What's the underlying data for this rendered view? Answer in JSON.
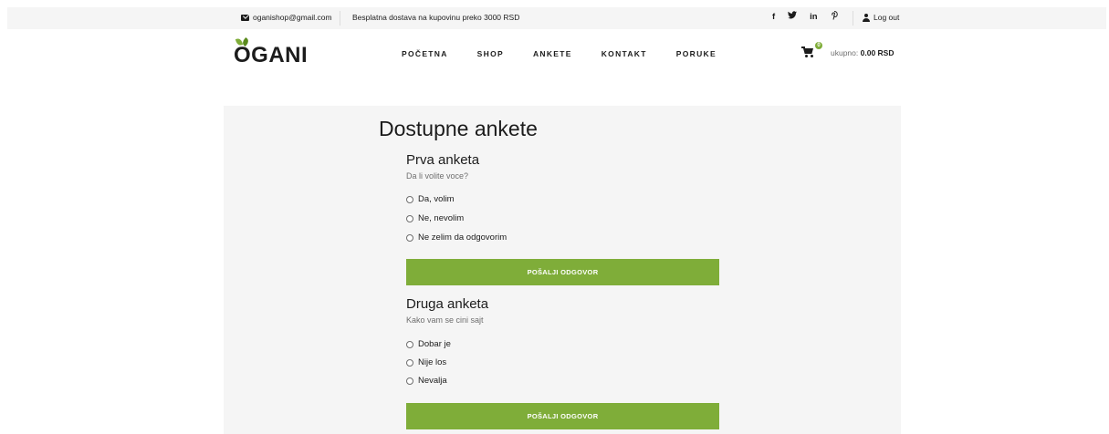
{
  "topbar": {
    "email": "oganishop@gmail.com",
    "shipping": "Besplatna dostava na kupovinu preko 3000 RSD",
    "social": [
      "f",
      "y",
      "in",
      "p"
    ],
    "logout": "Log out"
  },
  "header": {
    "logo": "OGANI",
    "nav": [
      "POČETNA",
      "SHOP",
      "ANKETE",
      "KONTAKT",
      "PORUKE"
    ],
    "cart_count": "0",
    "total_label": "ukupno:",
    "total_value": "0.00 RSD"
  },
  "main": {
    "title": "Dostupne ankete",
    "surveys": [
      {
        "title": "Prva anketa",
        "question": "Da li volite voce?",
        "options": [
          "Da, volim",
          "Ne, nevolim",
          "Ne zelim da odgovorim"
        ],
        "submit": "POŠALJI ODGOVOR"
      },
      {
        "title": "Druga anketa",
        "question": "Kako vam se cini sajt",
        "options": [
          "Dobar je",
          "Nije los",
          "Nevalja"
        ],
        "submit": "POŠALJI ODGOVOR"
      }
    ]
  },
  "colors": {
    "accent": "#7fad39",
    "topbar_bg": "#f5f5f5",
    "text": "#1c1c1c"
  },
  "icons": [
    "mail-icon",
    "facebook-icon",
    "twitter-icon",
    "linkedin-icon",
    "pinterest-icon",
    "user-icon",
    "cart-icon"
  ]
}
